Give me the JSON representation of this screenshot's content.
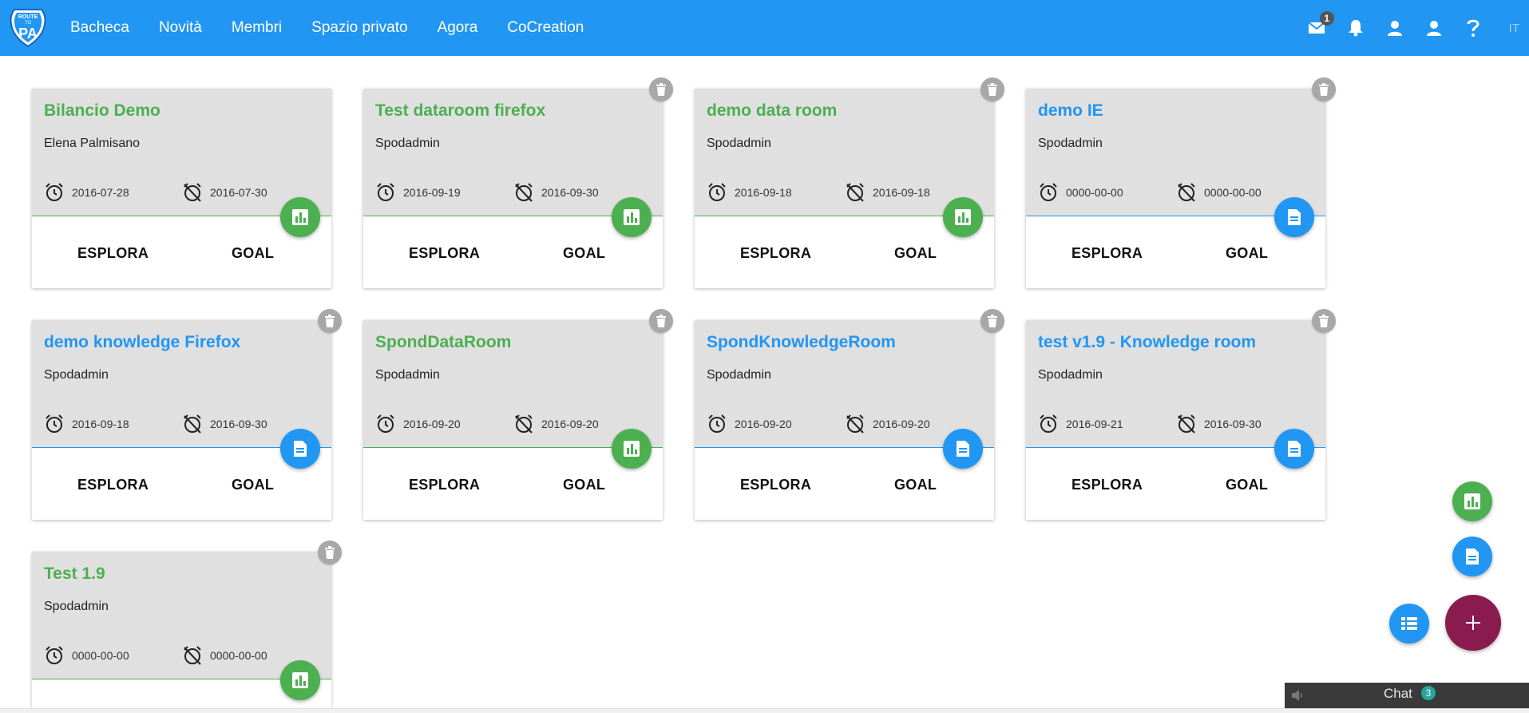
{
  "header": {
    "logo_text_top": "ROUTE",
    "logo_text_mid": "TO",
    "logo_text_main": "PA",
    "nav": [
      "Bacheca",
      "Novità",
      "Membri",
      "Spazio privato",
      "Agora",
      "CoCreation"
    ],
    "mail_badge": "1",
    "language": "IT"
  },
  "colors": {
    "brand": "#2196f3",
    "data_room": "#4caf50",
    "knowledge_room": "#2196f3",
    "add_fab": "#8a1b4f"
  },
  "labels": {
    "explore": "ESPLORA",
    "goal": "GOAL"
  },
  "cards": [
    {
      "title": "Bilancio Demo",
      "owner": "Elena Palmisano",
      "start": "2016-07-28",
      "end": "2016-07-30",
      "kind": "data",
      "deletable": false
    },
    {
      "title": "Test dataroom firefox",
      "owner": "Spodadmin",
      "start": "2016-09-19",
      "end": "2016-09-30",
      "kind": "data",
      "deletable": true
    },
    {
      "title": "demo data room",
      "owner": "Spodadmin",
      "start": "2016-09-18",
      "end": "2016-09-18",
      "kind": "data",
      "deletable": true
    },
    {
      "title": "demo IE",
      "owner": "Spodadmin",
      "start": "0000-00-00",
      "end": "0000-00-00",
      "kind": "knowledge",
      "deletable": true
    },
    {
      "title": "demo knowledge Firefox",
      "owner": "Spodadmin",
      "start": "2016-09-18",
      "end": "2016-09-30",
      "kind": "knowledge",
      "deletable": true
    },
    {
      "title": "SpondDataRoom",
      "owner": "Spodadmin",
      "start": "2016-09-20",
      "end": "2016-09-20",
      "kind": "data",
      "deletable": true
    },
    {
      "title": "SpondKnowledgeRoom",
      "owner": "Spodadmin",
      "start": "2016-09-20",
      "end": "2016-09-20",
      "kind": "knowledge",
      "deletable": true
    },
    {
      "title": "test v1.9 - Knowledge room",
      "owner": "Spodadmin",
      "start": "2016-09-21",
      "end": "2016-09-30",
      "kind": "knowledge",
      "deletable": true
    },
    {
      "title": "Test 1.9",
      "owner": "Spodadmin",
      "start": "0000-00-00",
      "end": "0000-00-00",
      "kind": "data",
      "deletable": true
    }
  ],
  "chat": {
    "label": "Chat",
    "badge": "3"
  }
}
